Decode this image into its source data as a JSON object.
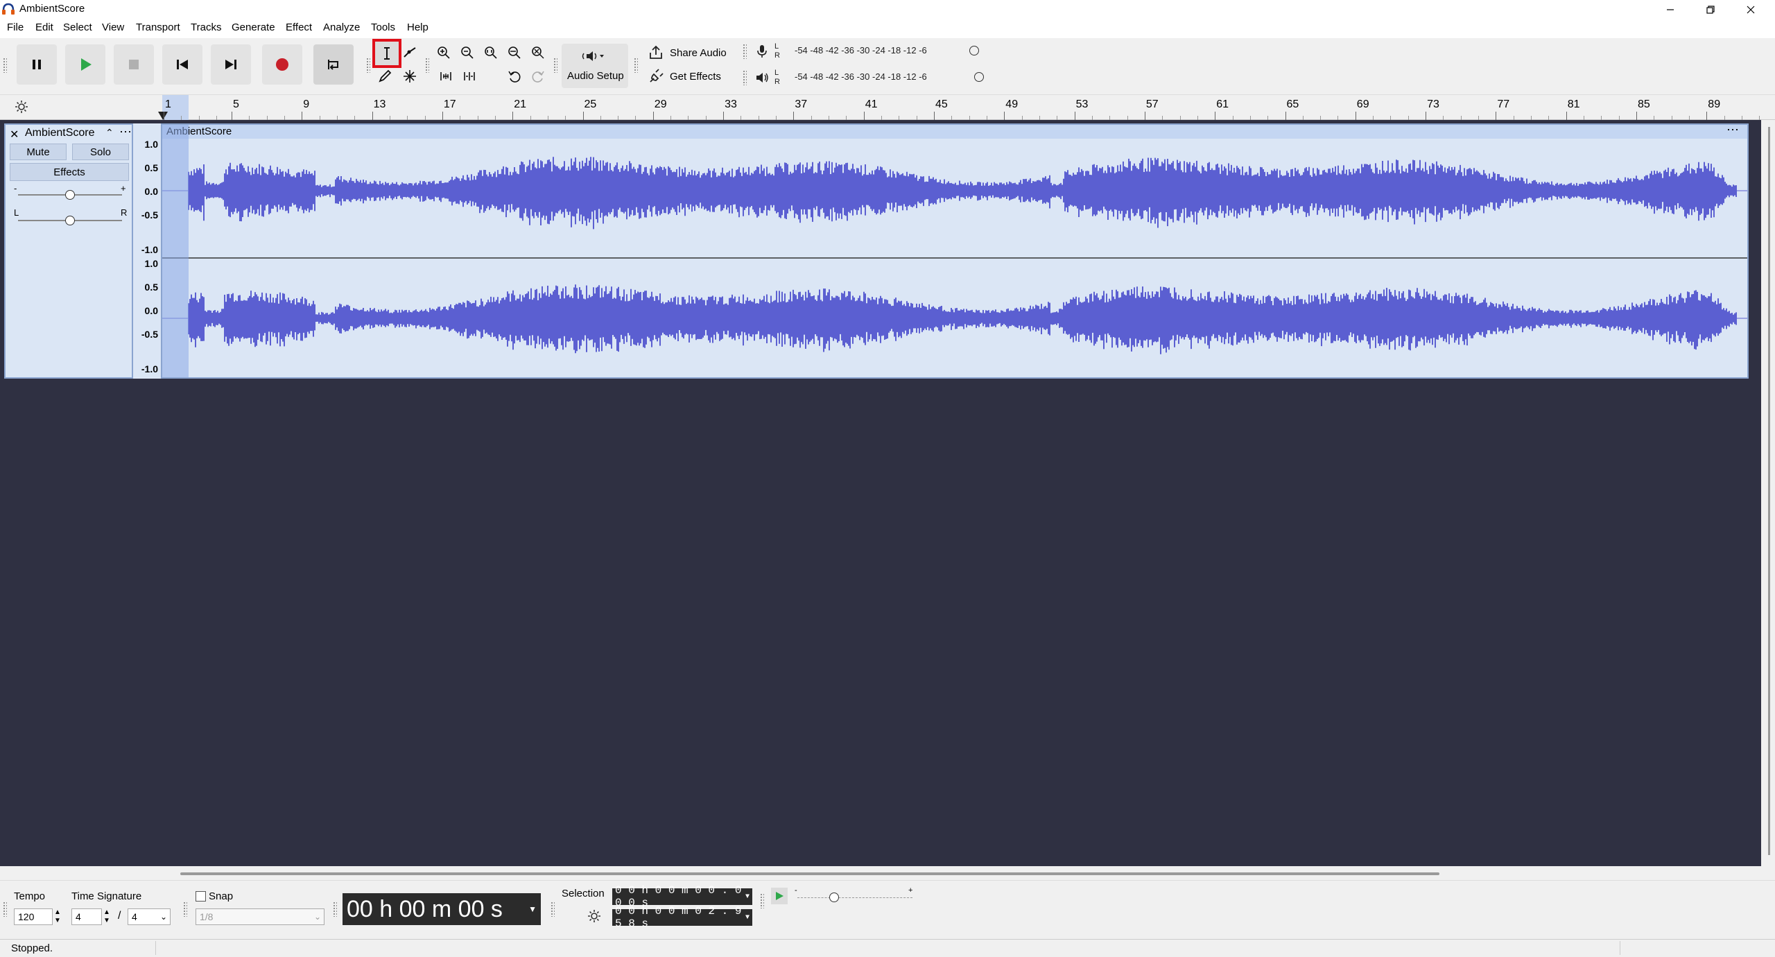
{
  "window": {
    "title": "AmbientScore",
    "icon": "audacity-headphones-icon",
    "controls": [
      "minimize-icon",
      "restore-icon",
      "close-icon"
    ]
  },
  "menu": [
    "File",
    "Edit",
    "Select",
    "View",
    "Transport",
    "Tracks",
    "Generate",
    "Effect",
    "Analyze",
    "Tools",
    "Help"
  ],
  "toolbar": {
    "transport": [
      "pause-icon",
      "play-icon",
      "stop-icon",
      "skip-to-start-icon",
      "skip-to-end-icon",
      "record-icon",
      "loop-icon"
    ],
    "tools": {
      "selected": "selection-tool-icon",
      "items": [
        "selection-tool-icon",
        "envelope-tool-icon",
        "draw-tool-icon",
        "multi-tool-icon"
      ]
    },
    "edit": [
      "zoom-in-icon",
      "zoom-out-icon",
      "fit-selection-icon",
      "fit-project-icon",
      "zoom-toggle-icon",
      "trim-icon",
      "silence-icon",
      "undo-icon",
      "redo-icon"
    ],
    "audio_setup_label": "Audio Setup",
    "share_audio_label": "Share Audio",
    "get_effects_label": "Get Effects",
    "meter_scale": "-54  -48  -42  -36  -30  -24  -18  -12   -6",
    "meter_l": "L",
    "meter_r": "R"
  },
  "ruler": {
    "labels": [
      "1",
      "5",
      "9",
      "13",
      "17",
      "21",
      "25",
      "29",
      "33",
      "37",
      "41",
      "45",
      "49",
      "53",
      "57",
      "61",
      "65",
      "69",
      "73",
      "77",
      "81",
      "85",
      "89"
    ]
  },
  "track": {
    "name": "AmbientScore",
    "mute_label": "Mute",
    "solo_label": "Solo",
    "effects_label": "Effects",
    "gain_minus": "-",
    "gain_plus": "+",
    "pan_left": "L",
    "pan_right": "R",
    "clip_name": "AmbientScore",
    "scale_top": [
      "1.0",
      "0.5",
      "0.0",
      "-0.5",
      "-1.0"
    ],
    "scale_bottom": [
      "1.0",
      "0.5",
      "0.0",
      "-0.5",
      "-1.0"
    ],
    "wave_color": "#5b5fd1"
  },
  "bottom": {
    "tempo_label": "Tempo",
    "tempo_value": "120",
    "time_sig_label": "Time Signature",
    "time_sig_num": "4",
    "time_sig_slash": "/",
    "time_sig_den": "4",
    "snap_label": "Snap",
    "snap_value": "1/8",
    "time_display": "00 h 00 m 00 s",
    "selection_label": "Selection",
    "selection_start": "0 0 h 0 0 m 0 0 . 0 0 0 s",
    "selection_end": "0 0 h 0 0 m 0 2 . 9 5 8 s",
    "speed_minus": "-",
    "speed_plus": "+"
  },
  "status": "Stopped."
}
